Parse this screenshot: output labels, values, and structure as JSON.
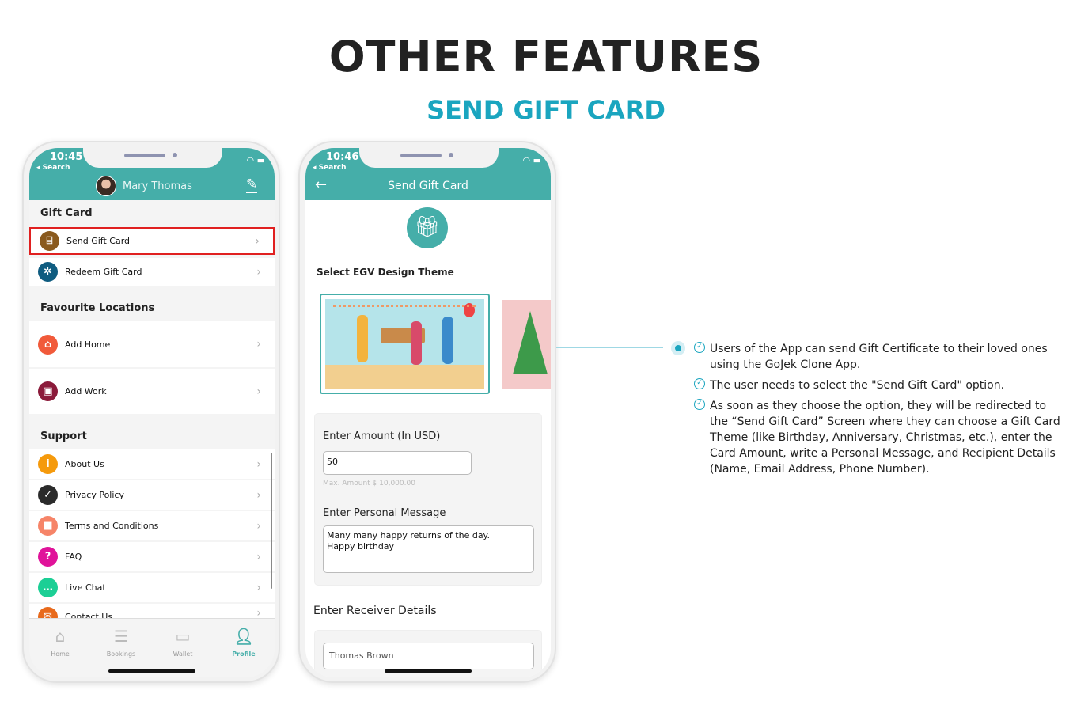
{
  "page": {
    "title": "OTHER FEATURES",
    "subtitle": "SEND GIFT CARD"
  },
  "colors": {
    "accent": "#45aea9",
    "highlight": "#e02020",
    "subtitle": "#1aa5bf"
  },
  "phone1": {
    "time": "10:45",
    "back": "◂ Search",
    "user_name": "Mary Thomas",
    "edit_icon": "pencil-icon",
    "sections": {
      "gift": "Gift Card",
      "fav": "Favourite Locations",
      "support": "Support"
    },
    "items": [
      {
        "label": "Send Gift Card",
        "icon": "gift-icon",
        "color": "#8a5a1e"
      },
      {
        "label": "Redeem Gift Card",
        "icon": "redeem-icon",
        "color": "#0f5c80"
      },
      {
        "label": "Add Home",
        "icon": "home-pin-icon",
        "color": "#f15a3a"
      },
      {
        "label": "Add Work",
        "icon": "work-pin-icon",
        "color": "#8b1a3a"
      },
      {
        "label": "About Us",
        "icon": "info-icon",
        "color": "#f59a0c"
      },
      {
        "label": "Privacy Policy",
        "icon": "privacy-icon",
        "color": "#2b2b2b"
      },
      {
        "label": "Terms and Conditions",
        "icon": "lock-icon",
        "color": "#f68468"
      },
      {
        "label": "FAQ",
        "icon": "question-icon",
        "color": "#e0139a"
      },
      {
        "label": "Live Chat",
        "icon": "chat-icon",
        "color": "#1ccf95"
      },
      {
        "label": "Contact Us",
        "icon": "mail-icon",
        "color": "#e86a1c"
      }
    ],
    "tabs": [
      {
        "label": "Home",
        "icon": "home-icon"
      },
      {
        "label": "Bookings",
        "icon": "bookings-icon"
      },
      {
        "label": "Wallet",
        "icon": "wallet-icon"
      },
      {
        "label": "Profile",
        "icon": "profile-icon",
        "active": true
      }
    ]
  },
  "phone2": {
    "time": "10:46",
    "back": "◂ Search",
    "title": "Send Gift Card",
    "theme_label": "Select EGV Design Theme",
    "amount_label": "Enter Amount (In USD)",
    "amount_value": "50",
    "amount_hint": "Max. Amount $ 10,000.00",
    "message_label": "Enter Personal Message",
    "message_value": "Many many happy returns of the day.\nHappy birthday",
    "receiver_label": "Enter Receiver Details",
    "receiver_name": "Thomas Brown"
  },
  "bullets": [
    "Users of the App can send Gift Certificate to their loved ones using the GoJek Clone App.",
    "The user needs to select the \"Send Gift Card\" option.",
    "As soon as they choose the option, they will be redirected to the “Send Gift Card” Screen where they can choose a Gift Card Theme (like Birthday, Anniversary, Christmas, etc.), enter the Card Amount, write a Personal Message, and Recipient Details (Name, Email Address, Phone Number)."
  ]
}
